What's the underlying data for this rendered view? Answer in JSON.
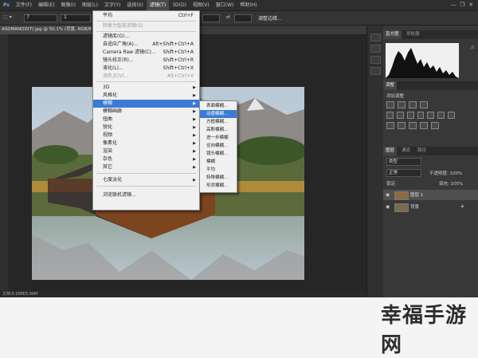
{
  "menubar": [
    "文件(F)",
    "编辑(E)",
    "图像(I)",
    "图层(L)",
    "文字(Y)",
    "选择(S)",
    "滤镜(T)",
    "3D(D)",
    "视图(V)",
    "窗口(W)",
    "帮助(H)"
  ],
  "menubar_active": "滤镜(T)",
  "options": {
    "field1": "7",
    "field2": "1",
    "right_btn": "调整边缘..."
  },
  "doc_tab": "ASDMANOD(T).jpg @ 50.1% (背景, RGB/8) *",
  "status": "文档:5.00M/5.00M",
  "filter_menu": {
    "items": [
      {
        "label": "平均",
        "shortcut": "Ctrl+F"
      },
      {
        "label": "转换为智能滤镜(S)",
        "disabled": true
      },
      {
        "label": "滤镜库(G)..."
      },
      {
        "label": "自适应广角(A)...",
        "shortcut": "Alt+Shift+Ctrl+A"
      },
      {
        "label": "Camera Raw 滤镜(C)...",
        "shortcut": "Shift+Ctrl+A"
      },
      {
        "label": "镜头校正(R)...",
        "shortcut": "Shift+Ctrl+R"
      },
      {
        "label": "液化(L)...",
        "shortcut": "Shift+Ctrl+X"
      },
      {
        "label": "消失点(V)...",
        "shortcut": "Alt+Ctrl+V",
        "disabled": true
      },
      {
        "label": "3D"
      },
      {
        "label": "风格化"
      },
      {
        "label": "模糊",
        "highlight": true
      },
      {
        "label": "模糊画廊"
      },
      {
        "label": "扭曲"
      },
      {
        "label": "锐化"
      },
      {
        "label": "视频"
      },
      {
        "label": "像素化"
      },
      {
        "label": "渲染"
      },
      {
        "label": "杂色"
      },
      {
        "label": "其它"
      },
      {
        "label": "七度淡化"
      },
      {
        "label": "浏览联机滤镜..."
      }
    ]
  },
  "blur_submenu": [
    "表面模糊...",
    "动感模糊...",
    "方框模糊...",
    "高斯模糊...",
    "进一步模糊",
    "径向模糊...",
    "镜头模糊...",
    "模糊",
    "平均",
    "特殊模糊...",
    "形状模糊..."
  ],
  "blur_submenu_highlight": "动感模糊...",
  "panels": {
    "top_tabs": [
      "直方图",
      "导航器"
    ],
    "adjust_tab": "调整",
    "adjust_hint": "添加调整",
    "layer_tabs": [
      "图层",
      "通道",
      "路径"
    ],
    "kind": "类型",
    "blend_mode": "正常",
    "opacity": "不透明度: 100%",
    "lock": "锁定:",
    "fill": "填充: 100%",
    "layers": [
      {
        "name": "图层 1",
        "selected": true
      },
      {
        "name": "背景",
        "locked": true
      }
    ]
  },
  "watermark": "幸福手游网",
  "colors": {
    "menu_highlight": "#3b7bd5",
    "app_bg": "#282828"
  }
}
